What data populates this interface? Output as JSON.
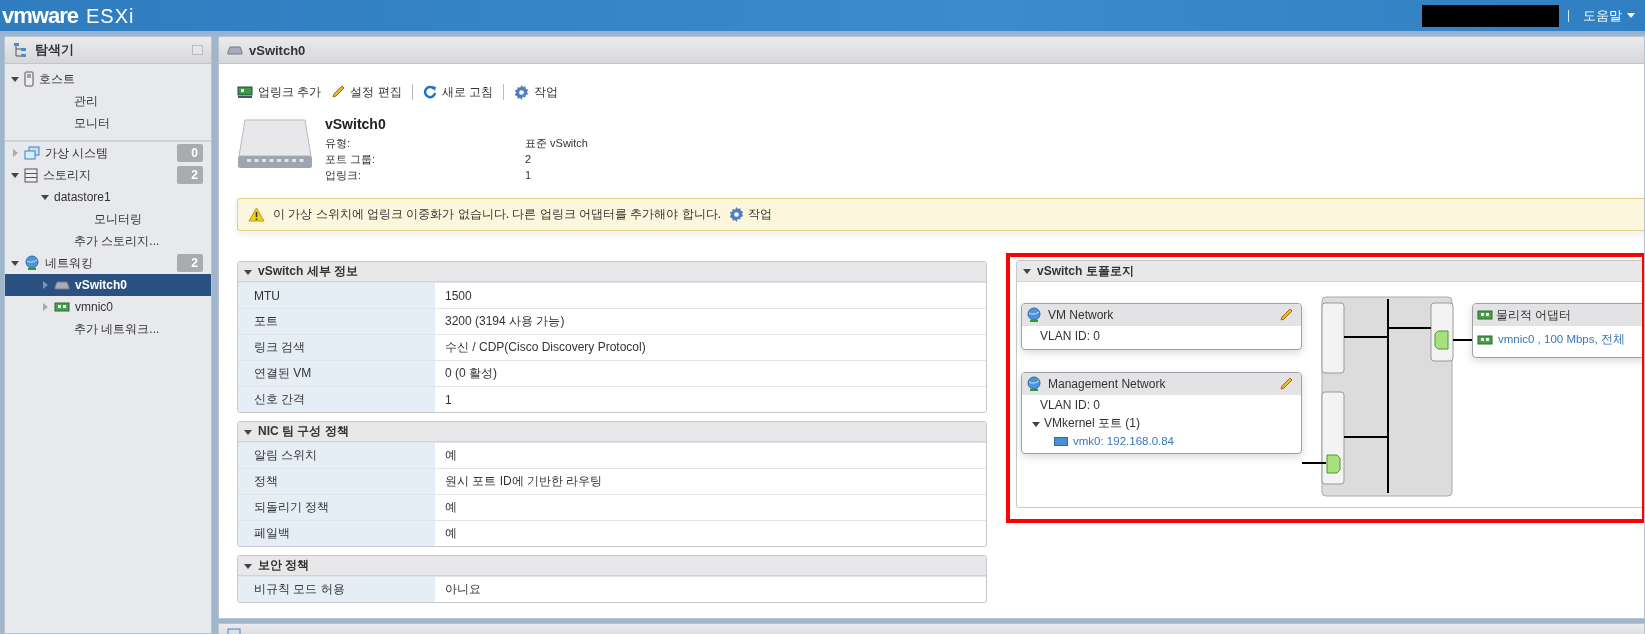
{
  "header": {
    "logo": [
      "vmware",
      "ESXi"
    ],
    "help": "도움말"
  },
  "navigator": {
    "title": "탐색기",
    "items": [
      {
        "label": "호스트",
        "kind": "host",
        "expanded": true,
        "selected": false,
        "children": [
          {
            "label": "관리",
            "kind": "link",
            "selected": false
          },
          {
            "label": "모니터",
            "kind": "link",
            "selected": false
          }
        ]
      },
      {
        "label": "가상 시스템",
        "kind": "vms",
        "expanded": false,
        "selected": false,
        "count": "0",
        "divider": true
      },
      {
        "label": "스토리지",
        "kind": "storage",
        "expanded": true,
        "selected": false,
        "count": "2",
        "children": [
          {
            "label": "datastore1",
            "kind": "datastore",
            "expanded": true,
            "selected": false,
            "children": [
              {
                "label": "모니터링",
                "kind": "link",
                "selected": false
              }
            ]
          },
          {
            "label": "추가 스토리지...",
            "kind": "link",
            "selected": false
          }
        ]
      },
      {
        "label": "네트워킹",
        "kind": "network",
        "expanded": true,
        "selected": false,
        "count": "2",
        "children": [
          {
            "label": "vSwitch0",
            "kind": "switch",
            "expanded": false,
            "selected": true
          },
          {
            "label": "vmnic0",
            "kind": "nic",
            "expanded": false,
            "selected": false
          },
          {
            "label": "추가 네트워크...",
            "kind": "link",
            "selected": false
          }
        ]
      }
    ]
  },
  "main": {
    "title": "vSwitch0",
    "toolbar": [
      {
        "label": "업링크 추가",
        "kind": "uplink",
        "separator_before": false
      },
      {
        "label": "설정 편집",
        "kind": "edit",
        "separator_before": false
      },
      {
        "label": "새로 고침",
        "kind": "refresh",
        "separator_before": true
      },
      {
        "label": "작업",
        "kind": "actions",
        "separator_before": true
      }
    ],
    "summary": {
      "name": "vSwitch0",
      "rows": [
        {
          "label": "유형:",
          "value": "표준 vSwitch"
        },
        {
          "label": "포트 그룹:",
          "value": "2"
        },
        {
          "label": "업링크:",
          "value": "1"
        }
      ]
    },
    "warning": {
      "message": "이 가상 스위치에 업링크 이중화가 없습니다. 다른 업링크 어댑터를 추가해야 합니다.",
      "action": "작업"
    },
    "sections": [
      {
        "title": "vSwitch 세부 정보",
        "expanded": true,
        "rows": [
          {
            "label": "MTU",
            "value": "1500"
          },
          {
            "label": "포트",
            "value": "3200 (3194 사용 가능)"
          },
          {
            "label": "링크 검색",
            "value": "수신 / CDP(Cisco Discovery Protocol)"
          },
          {
            "label": "연결된 VM",
            "value": "0 (0 활성)"
          },
          {
            "label": "신호 간격",
            "value": "1"
          }
        ]
      },
      {
        "title": "NIC 팀 구성 정책",
        "expanded": true,
        "rows": [
          {
            "label": "알림 스위치",
            "value": "예"
          },
          {
            "label": "정책",
            "value": "원시 포트 ID에 기반한 라우팅"
          },
          {
            "label": "되돌리기 정책",
            "value": "예"
          },
          {
            "label": "페일백",
            "value": "예"
          }
        ]
      },
      {
        "title": "보안 정책",
        "expanded": true,
        "rows": [
          {
            "label": "비규칙 모드 허용",
            "value": "아니요"
          }
        ]
      }
    ],
    "topology": {
      "title": "vSwitch 토폴로지",
      "expanded": true,
      "port_groups": [
        {
          "name": "VM Network",
          "vlan": "VLAN ID: 0"
        },
        {
          "name": "Management Network",
          "vlan": "VLAN ID: 0",
          "vmkernel": {
            "label": "VMkernel 포트 (1)",
            "expanded": true,
            "ports": [
              "vmk0: 192.168.0.84"
            ]
          }
        }
      ],
      "adapters": {
        "title": "물리적 어댑터",
        "nics": [
          "vmnic0 , 100 Mbps, 전체"
        ]
      }
    }
  }
}
